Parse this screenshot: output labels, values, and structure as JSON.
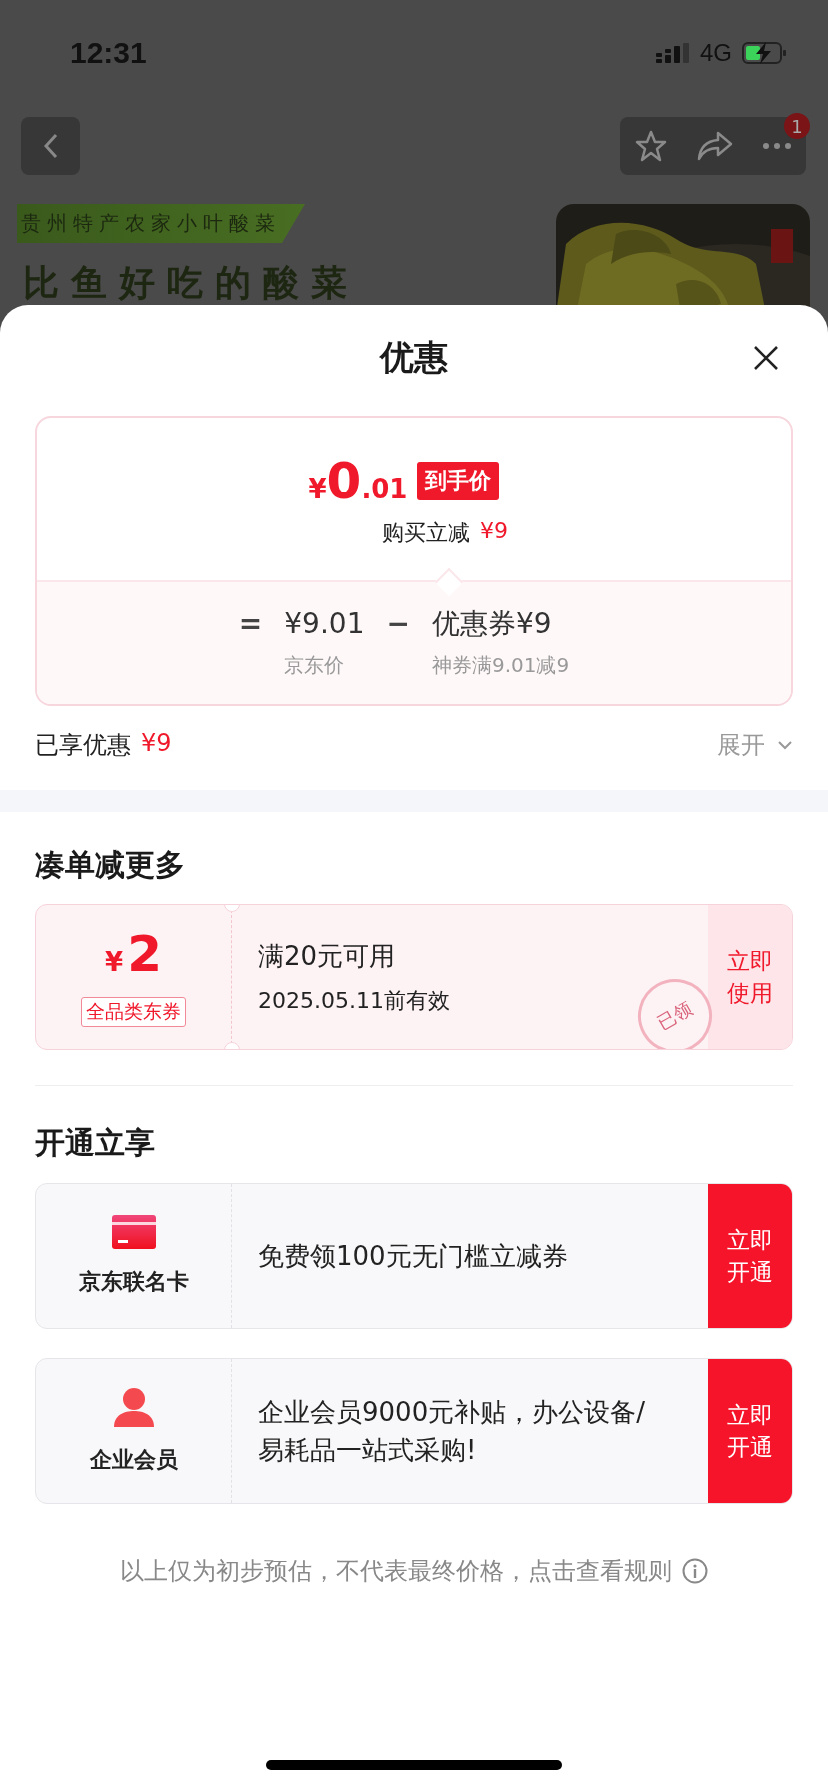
{
  "status_bar": {
    "time": "12:31",
    "network": "4G"
  },
  "page_behind": {
    "badge": "1",
    "tag": "贵州特产农家小叶酸菜",
    "headline": "比鱼好吃的酸菜"
  },
  "sheet": {
    "title": "优惠",
    "price_card": {
      "currency": "¥",
      "price_int": "0",
      "price_dec": ".01",
      "price_tag": "到手价",
      "instant_label": "购买立减",
      "instant_amount": "¥9",
      "terms": [
        {
          "op": "=",
          "value": "¥9.01",
          "label": "京东价"
        },
        {
          "op": "−",
          "value": "优惠券¥9",
          "label": "神券满9.01减9"
        }
      ]
    },
    "enjoyed": {
      "label": "已享优惠",
      "amount": "¥9"
    },
    "expand": {
      "label": "展开",
      "expanded": false
    },
    "more_section": {
      "title": "凑单减更多",
      "coupon": {
        "currency": "¥",
        "amount": "2",
        "type": "全品类东券",
        "condition": "满20元可用",
        "validity": "2025.05.11前有效",
        "stamp": "已领",
        "action": "立即使用"
      }
    },
    "membership": {
      "title": "开通立享",
      "offers": [
        {
          "kind": "card",
          "name": "京东联名卡",
          "text": "免费领100元无门槛立减券",
          "action": "立即开通"
        },
        {
          "kind": "person",
          "name": "企业会员",
          "text": "企业会员9000元补贴，办公设备/易耗品一站式采购!",
          "action": "立即开通"
        }
      ]
    },
    "footer": {
      "note": "以上仅为初步预估，不代表最终价格，点击查看规则"
    }
  }
}
